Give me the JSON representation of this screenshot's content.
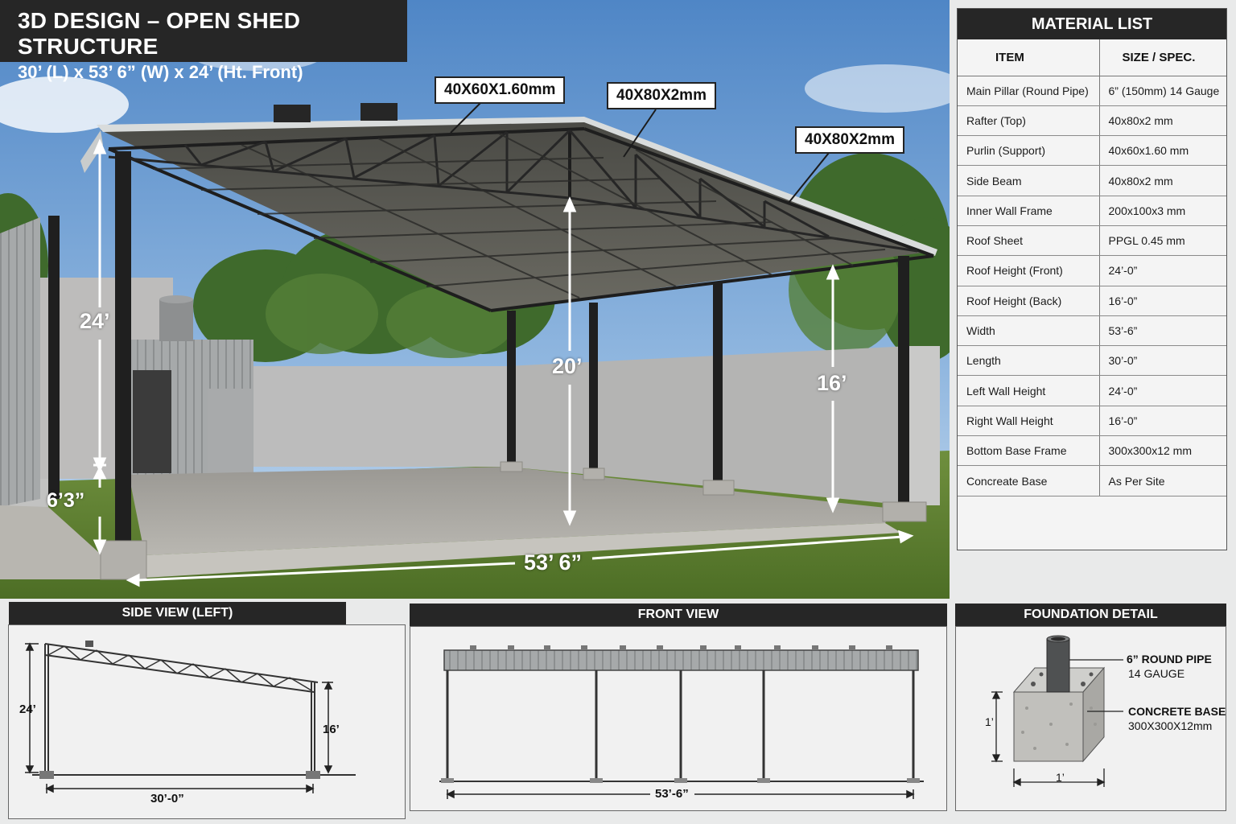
{
  "title": {
    "line1": "3D DESIGN – OPEN SHED STRUCTURE",
    "line2": "30’ (L) x 53’ 6” (W) x 24’ (Ht. Front)"
  },
  "callouts": {
    "purlin": "40X60X1.60mm",
    "rafter_mid": "40X80X2mm",
    "rafter_right": "40X80X2mm"
  },
  "dimensions": {
    "left_height": "24’",
    "base_height": "6’3”",
    "center_height": "20’",
    "right_height": "16’",
    "width": "53’ 6”"
  },
  "material_list": {
    "title": "MATERIAL LIST",
    "col_item": "ITEM",
    "col_spec": "SIZE / SPEC.",
    "rows": [
      {
        "item": "Main Pillar (Round Pipe)",
        "spec": "6” (150mm) 14 Gauge"
      },
      {
        "item": "Rafter (Top)",
        "spec": "40x80x2 mm"
      },
      {
        "item": "Purlin (Support)",
        "spec": "40x60x1.60 mm"
      },
      {
        "item": "Side Beam",
        "spec": "40x80x2 mm"
      },
      {
        "item": "Inner Wall Frame",
        "spec": "200x100x3 mm"
      },
      {
        "item": "Roof Sheet",
        "spec": "PPGL 0.45 mm"
      },
      {
        "item": "Roof Height (Front)",
        "spec": "24’-0”"
      },
      {
        "item": "Roof Height (Back)",
        "spec": "16’-0”"
      },
      {
        "item": "Width",
        "spec": "53’-6”"
      },
      {
        "item": "Length",
        "spec": "30’-0”"
      },
      {
        "item": "Left Wall Height",
        "spec": "24’-0”"
      },
      {
        "item": "Right Wall Height",
        "spec": "16’-0”"
      },
      {
        "item": "Bottom Base Frame",
        "spec": "300x300x12 mm"
      },
      {
        "item": "Concreate Base",
        "spec": "As Per Site"
      }
    ]
  },
  "side_view": {
    "title": "SIDE VIEW (LEFT)",
    "left_height": "24’",
    "right_height": "16’",
    "length": "30’-0”"
  },
  "front_view": {
    "title": "FRONT VIEW",
    "width": "53’-6”"
  },
  "foundation": {
    "title": "FOUNDATION DETAIL",
    "pipe_line1": "6” ROUND PIPE",
    "pipe_line2": "14 GAUGE",
    "base_line1": "CONCRETE BASE",
    "base_line2": "300X300X12mm",
    "height": "1’",
    "width": "1’"
  }
}
